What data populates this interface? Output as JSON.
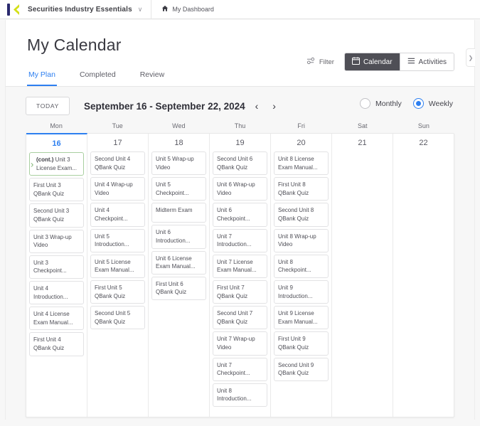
{
  "topbar": {
    "brand": "Securities Industry Essentials",
    "brand_caret": "∨",
    "dashboard_label": "My Dashboard",
    "home_icon": "⌂",
    "logo_bar_color": "#2b2a6e",
    "logo_k_color": "#d4e017"
  },
  "header": {
    "title": "My Calendar",
    "filter_label": "Filter",
    "calendar_label": "Calendar",
    "activities_label": "Activities",
    "calendar_icon": "calendar-icon",
    "activities_icon": "list-icon",
    "accent_color": "#2d7ff0",
    "active_seg_color": "#4f4f56"
  },
  "tabs": [
    {
      "label": "My Plan",
      "active": true
    },
    {
      "label": "Completed",
      "active": false
    },
    {
      "label": "Review",
      "active": false
    }
  ],
  "toolbar": {
    "today_label": "TODAY",
    "range_label": "September 16 - September 22, 2024",
    "prev_arrow": "‹",
    "next_arrow": "›",
    "monthly_label": "Monthly",
    "weekly_label": "Weekly",
    "selected_view": "Weekly"
  },
  "panel_toggle": {
    "icon": "❯"
  },
  "calendar": {
    "days": [
      {
        "dow": "Mon",
        "date": "16",
        "today": true,
        "events": [
          {
            "prefix": "(cont.)",
            "text": " Unit 3 License Exam...",
            "continued": true
          },
          {
            "text": "First Unit 3 QBank Quiz"
          },
          {
            "text": "Second Unit 3 QBank Quiz"
          },
          {
            "text": "Unit 3 Wrap-up Video"
          },
          {
            "text": "Unit 3 Checkpoint..."
          },
          {
            "text": "Unit 4 Introduction..."
          },
          {
            "text": "Unit 4 License Exam Manual..."
          },
          {
            "text": "First Unit 4 QBank Quiz"
          }
        ]
      },
      {
        "dow": "Tue",
        "date": "17",
        "today": false,
        "events": [
          {
            "text": "Second Unit 4 QBank Quiz"
          },
          {
            "text": "Unit 4 Wrap-up Video"
          },
          {
            "text": "Unit 4 Checkpoint..."
          },
          {
            "text": "Unit 5 Introduction..."
          },
          {
            "text": "Unit 5 License Exam Manual..."
          },
          {
            "text": "First Unit 5 QBank Quiz"
          },
          {
            "text": "Second Unit 5 QBank Quiz"
          }
        ]
      },
      {
        "dow": "Wed",
        "date": "18",
        "today": false,
        "events": [
          {
            "text": "Unit 5 Wrap-up Video"
          },
          {
            "text": "Unit 5 Checkpoint..."
          },
          {
            "text": "Midterm Exam"
          },
          {
            "text": "Unit 6 Introduction..."
          },
          {
            "text": "Unit 6 License Exam Manual..."
          },
          {
            "text": "First Unit 6 QBank Quiz"
          }
        ]
      },
      {
        "dow": "Thu",
        "date": "19",
        "today": false,
        "events": [
          {
            "text": "Second Unit 6 QBank Quiz"
          },
          {
            "text": "Unit 6 Wrap-up Video"
          },
          {
            "text": "Unit 6 Checkpoint..."
          },
          {
            "text": "Unit 7 Introduction..."
          },
          {
            "text": "Unit 7 License Exam Manual..."
          },
          {
            "text": "First Unit 7 QBank Quiz"
          },
          {
            "text": "Second Unit 7 QBank Quiz"
          },
          {
            "text": "Unit 7 Wrap-up Video"
          },
          {
            "text": "Unit 7 Checkpoint..."
          },
          {
            "text": "Unit 8 Introduction..."
          }
        ]
      },
      {
        "dow": "Fri",
        "date": "20",
        "today": false,
        "events": [
          {
            "text": "Unit 8 License Exam Manual..."
          },
          {
            "text": "First Unit 8 QBank Quiz"
          },
          {
            "text": "Second Unit 8 QBank Quiz"
          },
          {
            "text": "Unit 8 Wrap-up Video"
          },
          {
            "text": "Unit 8 Checkpoint..."
          },
          {
            "text": "Unit 9 Introduction..."
          },
          {
            "text": "Unit 9 License Exam Manual..."
          },
          {
            "text": "First Unit 9 QBank Quiz"
          },
          {
            "text": "Second Unit 9 QBank Quiz"
          }
        ]
      },
      {
        "dow": "Sat",
        "date": "21",
        "today": false,
        "events": []
      },
      {
        "dow": "Sun",
        "date": "22",
        "today": false,
        "events": []
      }
    ]
  }
}
